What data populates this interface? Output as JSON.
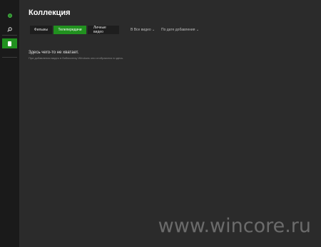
{
  "sidebar": {
    "icons": [
      "xbox-logo-icon",
      "search-icon",
      "collection-icon"
    ]
  },
  "header": {
    "title": "Коллекция"
  },
  "tabs": [
    {
      "label": "Фильмы"
    },
    {
      "label": "Телепередачи"
    },
    {
      "label": "Личные видео"
    }
  ],
  "filters": {
    "show": "В Все видео ⌄",
    "sort": "По дате добавления ⌄"
  },
  "empty_state": {
    "heading": "Здесь чего-то не хватает.",
    "message": "При добавлении видео в библиотеку Windows они отобразятся в здесь."
  },
  "watermark": {
    "text": "www.wincore.ru"
  },
  "colors": {
    "accent": "#21911f",
    "background": "#2b2b2b",
    "sidebar": "#1a1a1a"
  }
}
